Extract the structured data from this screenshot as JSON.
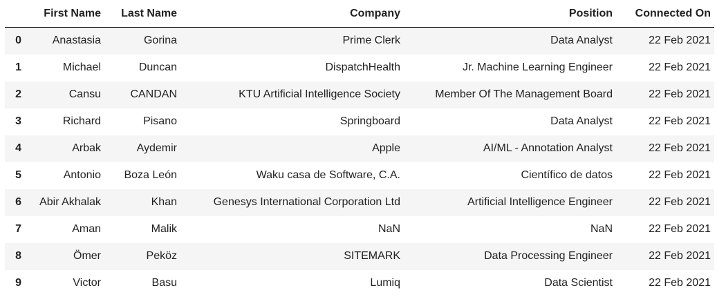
{
  "table": {
    "columns": [
      "First Name",
      "Last Name",
      "Company",
      "Position",
      "Connected On"
    ],
    "rows": [
      {
        "index": "0",
        "cells": [
          "Anastasia",
          "Gorina",
          "Prime Clerk",
          "Data Analyst",
          "22 Feb 2021"
        ]
      },
      {
        "index": "1",
        "cells": [
          "Michael",
          "Duncan",
          "DispatchHealth",
          "Jr. Machine Learning Engineer",
          "22 Feb 2021"
        ]
      },
      {
        "index": "2",
        "cells": [
          "Cansu",
          "CANDAN",
          "KTU Artificial Intelligence Society",
          "Member Of The Management Board",
          "22 Feb 2021"
        ]
      },
      {
        "index": "3",
        "cells": [
          "Richard",
          "Pisano",
          "Springboard",
          "Data Analyst",
          "22 Feb 2021"
        ]
      },
      {
        "index": "4",
        "cells": [
          "Arbak",
          "Aydemir",
          "Apple",
          "AI/ML - Annotation Analyst",
          "22 Feb 2021"
        ]
      },
      {
        "index": "5",
        "cells": [
          "Antonio",
          "Boza León",
          "Waku casa de Software, C.A.",
          "Científico de datos",
          "22 Feb 2021"
        ]
      },
      {
        "index": "6",
        "cells": [
          "Abir Akhalak",
          "Khan",
          "Genesys International Corporation Ltd",
          "Artificial Intelligence Engineer",
          "22 Feb 2021"
        ]
      },
      {
        "index": "7",
        "cells": [
          "Aman",
          "Malik",
          "NaN",
          "NaN",
          "22 Feb 2021"
        ]
      },
      {
        "index": "8",
        "cells": [
          "Ömer",
          "Peköz",
          "SITEMARK",
          "Data Processing Engineer",
          "22 Feb 2021"
        ]
      },
      {
        "index": "9",
        "cells": [
          "Victor",
          "Basu",
          "Lumiq",
          "Data Scientist",
          "22 Feb 2021"
        ]
      }
    ]
  }
}
